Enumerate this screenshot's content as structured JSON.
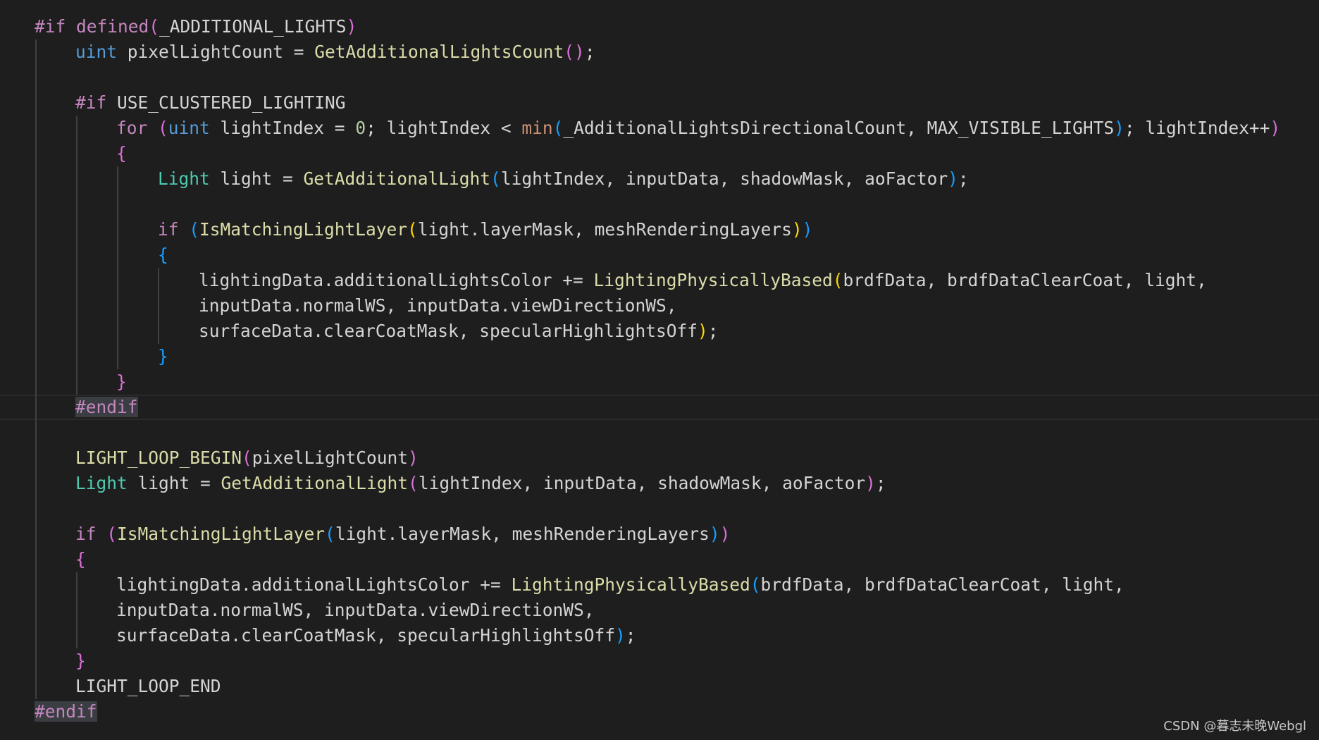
{
  "editor": {
    "lines": [
      [
        {
          "t": "#if ",
          "c": "kw"
        },
        {
          "t": "defined",
          "c": "kw"
        },
        {
          "t": "(",
          "c": "br2"
        },
        {
          "t": "_ADDITIONAL_LIGHTS",
          "c": ""
        },
        {
          "t": ")",
          "c": "br2"
        }
      ],
      [
        {
          "t": "uint",
          "c": "type"
        },
        {
          "t": " pixelLightCount = ",
          "c": ""
        },
        {
          "t": "GetAdditionalLightsCount",
          "c": "fn"
        },
        {
          "t": "()",
          "c": "br2"
        },
        {
          "t": ";",
          "c": ""
        }
      ],
      [],
      [
        {
          "t": "#if ",
          "c": "kw"
        },
        {
          "t": "USE_CLUSTERED_LIGHTING",
          "c": ""
        }
      ],
      [
        {
          "t": "for ",
          "c": "kw"
        },
        {
          "t": "(",
          "c": "br2"
        },
        {
          "t": "uint",
          "c": "type"
        },
        {
          "t": " lightIndex = ",
          "c": ""
        },
        {
          "t": "0",
          "c": "num"
        },
        {
          "t": "; lightIndex < ",
          "c": ""
        },
        {
          "t": "min",
          "c": "minfn"
        },
        {
          "t": "(",
          "c": "br3"
        },
        {
          "t": "_AdditionalLightsDirectionalCount, MAX_VISIBLE_LIGHTS",
          "c": ""
        },
        {
          "t": ")",
          "c": "br3"
        },
        {
          "t": "; lightIndex++",
          "c": ""
        },
        {
          "t": ")",
          "c": "br2"
        }
      ],
      [
        {
          "t": "{",
          "c": "br2"
        }
      ],
      [
        {
          "t": "Light",
          "c": "cls"
        },
        {
          "t": " light = ",
          "c": ""
        },
        {
          "t": "GetAdditionalLight",
          "c": "fn"
        },
        {
          "t": "(",
          "c": "br3"
        },
        {
          "t": "lightIndex, inputData, shadowMask, aoFactor",
          "c": ""
        },
        {
          "t": ")",
          "c": "br3"
        },
        {
          "t": ";",
          "c": ""
        }
      ],
      [],
      [
        {
          "t": "if ",
          "c": "kw"
        },
        {
          "t": "(",
          "c": "br3"
        },
        {
          "t": "IsMatchingLightLayer",
          "c": "fn"
        },
        {
          "t": "(",
          "c": "br1"
        },
        {
          "t": "light.layerMask, meshRenderingLayers",
          "c": ""
        },
        {
          "t": ")",
          "c": "br1"
        },
        {
          "t": ")",
          "c": "br3"
        }
      ],
      [
        {
          "t": "{",
          "c": "br3"
        }
      ],
      [
        {
          "t": "lightingData.additionalLightsColor += ",
          "c": ""
        },
        {
          "t": "LightingPhysicallyBased",
          "c": "fn"
        },
        {
          "t": "(",
          "c": "br1"
        },
        {
          "t": "brdfData, brdfDataClearCoat, light,",
          "c": ""
        }
      ],
      [
        {
          "t": "inputData.normalWS, inputData.viewDirectionWS,",
          "c": ""
        }
      ],
      [
        {
          "t": "surfaceData.clearCoatMask, specularHighlightsOff",
          "c": ""
        },
        {
          "t": ")",
          "c": "br1"
        },
        {
          "t": ";",
          "c": ""
        }
      ],
      [
        {
          "t": "}",
          "c": "br3"
        }
      ],
      [
        {
          "t": "}",
          "c": "br2"
        }
      ],
      [
        {
          "t": "#endif",
          "c": "kw sel"
        }
      ],
      [],
      [
        {
          "t": "LIGHT_LOOP_BEGIN",
          "c": "mac"
        },
        {
          "t": "(",
          "c": "br2"
        },
        {
          "t": "pixelLightCount",
          "c": ""
        },
        {
          "t": ")",
          "c": "br2"
        }
      ],
      [
        {
          "t": "Light",
          "c": "cls"
        },
        {
          "t": " light = ",
          "c": ""
        },
        {
          "t": "GetAdditionalLight",
          "c": "fn"
        },
        {
          "t": "(",
          "c": "br2"
        },
        {
          "t": "lightIndex, inputData, shadowMask, aoFactor",
          "c": ""
        },
        {
          "t": ")",
          "c": "br2"
        },
        {
          "t": ";",
          "c": ""
        }
      ],
      [],
      [
        {
          "t": "if ",
          "c": "kw"
        },
        {
          "t": "(",
          "c": "br2"
        },
        {
          "t": "IsMatchingLightLayer",
          "c": "fn"
        },
        {
          "t": "(",
          "c": "br3"
        },
        {
          "t": "light.layerMask, meshRenderingLayers",
          "c": ""
        },
        {
          "t": ")",
          "c": "br3"
        },
        {
          "t": ")",
          "c": "br2"
        }
      ],
      [
        {
          "t": "{",
          "c": "br2"
        }
      ],
      [
        {
          "t": "lightingData.additionalLightsColor += ",
          "c": ""
        },
        {
          "t": "LightingPhysicallyBased",
          "c": "fn"
        },
        {
          "t": "(",
          "c": "br3"
        },
        {
          "t": "brdfData, brdfDataClearCoat, light,",
          "c": ""
        }
      ],
      [
        {
          "t": "inputData.normalWS, inputData.viewDirectionWS,",
          "c": ""
        }
      ],
      [
        {
          "t": "surfaceData.clearCoatMask, specularHighlightsOff",
          "c": ""
        },
        {
          "t": ")",
          "c": "br3"
        },
        {
          "t": ";",
          "c": ""
        }
      ],
      [
        {
          "t": "}",
          "c": "br2"
        }
      ],
      [
        {
          "t": "LIGHT_LOOP_END",
          "c": ""
        }
      ],
      [
        {
          "t": "#endif",
          "c": "kw sel"
        }
      ]
    ]
  },
  "watermark": "CSDN @暮志未晚Webgl"
}
